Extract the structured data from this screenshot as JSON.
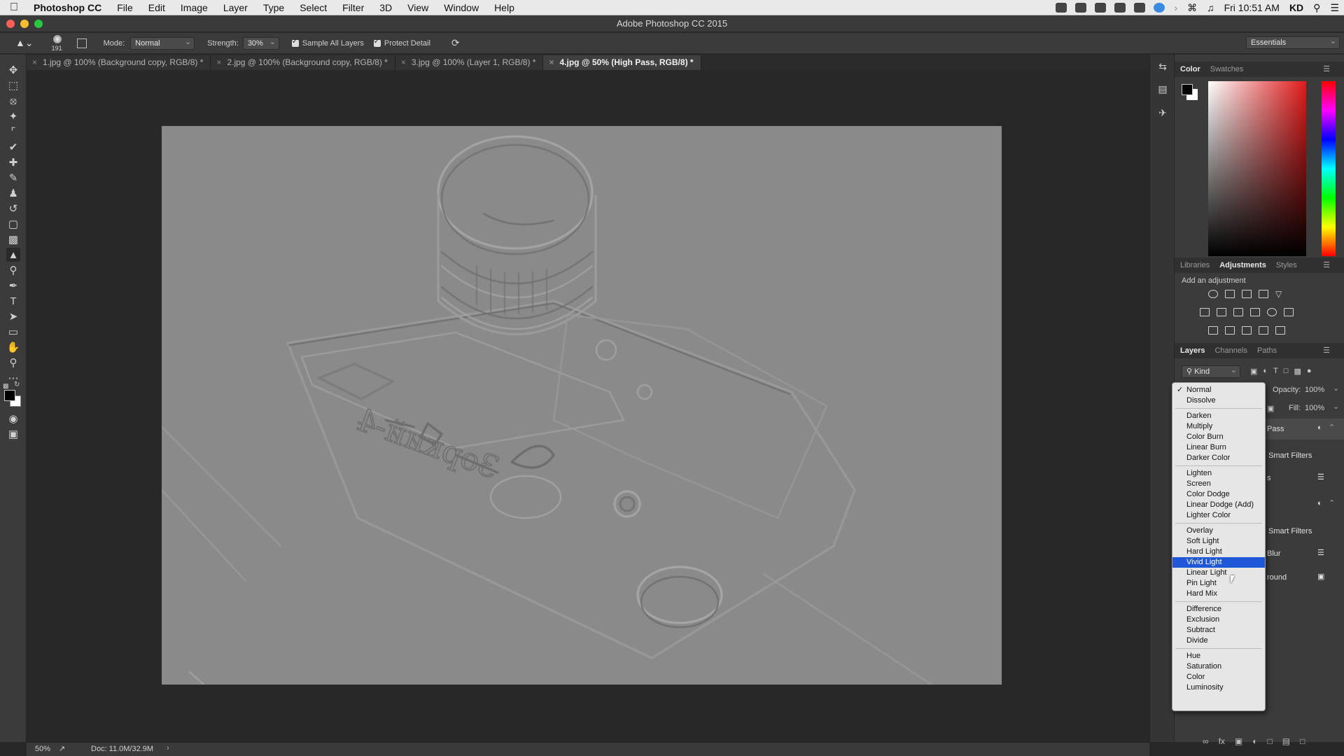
{
  "menubar": {
    "app_name": "Photoshop CC",
    "items": [
      "File",
      "Edit",
      "Image",
      "Layer",
      "Type",
      "Select",
      "Filter",
      "3D",
      "View",
      "Window",
      "Help"
    ],
    "clock": "Fri 10:51 AM",
    "user": "KD"
  },
  "window": {
    "title": "Adobe Photoshop CC 2015"
  },
  "options": {
    "brush_size": "191",
    "mode_label": "Mode:",
    "mode_value": "Normal",
    "strength_label": "Strength:",
    "strength_value": "30%",
    "sample_all_layers": "Sample All Layers",
    "protect_detail": "Protect Detail",
    "workspace": "Essentials"
  },
  "tabs": [
    {
      "label": "1.jpg @ 100% (Background copy, RGB/8) *"
    },
    {
      "label": "2.jpg @ 100% (Background copy, RGB/8) *"
    },
    {
      "label": "3.jpg @ 100% (Layer 1, RGB/8) *"
    },
    {
      "label": "4.jpg @ 50% (High Pass, RGB/8) *"
    }
  ],
  "status": {
    "zoom": "50%",
    "doc": "Doc: 11.0M/32.9M"
  },
  "panels": {
    "color_tabs": [
      "Color",
      "Swatches"
    ],
    "adjust_tabs": [
      "Libraries",
      "Adjustments",
      "Styles"
    ],
    "add_adjustment": "Add an adjustment",
    "layer_tabs": [
      "Layers",
      "Channels",
      "Paths"
    ],
    "kind": "Kind",
    "opacity_label": "Opacity:",
    "opacity_value": "100%",
    "fill_label": "Fill:",
    "fill_value": "100%"
  },
  "layers_partial": {
    "r1": "Pass",
    "r2": "Smart Filters",
    "r3": "s",
    "r4": "Smart Filters",
    "r5": "Blur",
    "r6": "round"
  },
  "blend_menu": {
    "group1": [
      "Normal",
      "Dissolve"
    ],
    "group2": [
      "Darken",
      "Multiply",
      "Color Burn",
      "Linear Burn",
      "Darker Color"
    ],
    "group3": [
      "Lighten",
      "Screen",
      "Color Dodge",
      "Linear Dodge (Add)",
      "Lighter Color"
    ],
    "group4": [
      "Overlay",
      "Soft Light",
      "Hard Light",
      "Vivid Light",
      "Linear Light",
      "Pin Light",
      "Hard Mix"
    ],
    "group5": [
      "Difference",
      "Exclusion",
      "Subtract",
      "Divide"
    ],
    "group6": [
      "Hue",
      "Saturation",
      "Color",
      "Luminosity"
    ],
    "checked": "Normal",
    "highlighted": "Vivid Light"
  },
  "canvas_text": {
    "engraving": "Зоркий-4"
  },
  "colors": {
    "highlight": "#2057d8",
    "image_gray": "#8a8a8a"
  }
}
